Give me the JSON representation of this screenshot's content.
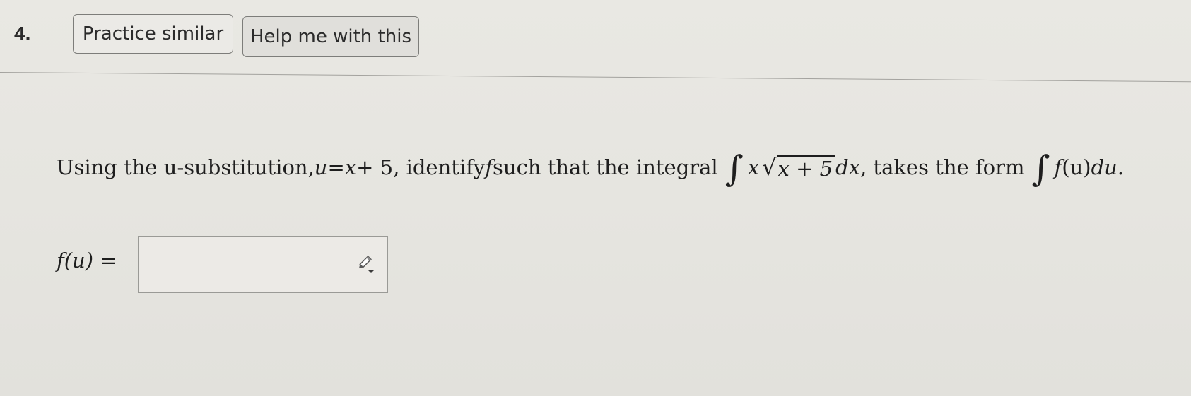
{
  "problem": {
    "number": "4."
  },
  "toolbar": {
    "practice_label": "Practice similar",
    "help_label": "Help me with this"
  },
  "question": {
    "intro": "Using the u-substitution, ",
    "substitution_var": "u",
    "substitution_eq": " = ",
    "substitution_expr_x": "x",
    "substitution_expr_rest": " + 5",
    "after_sub": ", identify ",
    "f_symbol": "f",
    "middle": " such that the integral ",
    "integral_symbol": "∫",
    "integrand_x": "x",
    "radical_symbol": "√",
    "radicand": "x + 5",
    "dx": " dx",
    "after_integral": ", takes the form ",
    "integral_symbol_2": "∫",
    "form_f": "f",
    "form_arg": "(u)",
    "du": " du",
    "end": "."
  },
  "answer": {
    "label": "f(u) =",
    "value": "",
    "icon": "pencil-dropdown-icon"
  }
}
